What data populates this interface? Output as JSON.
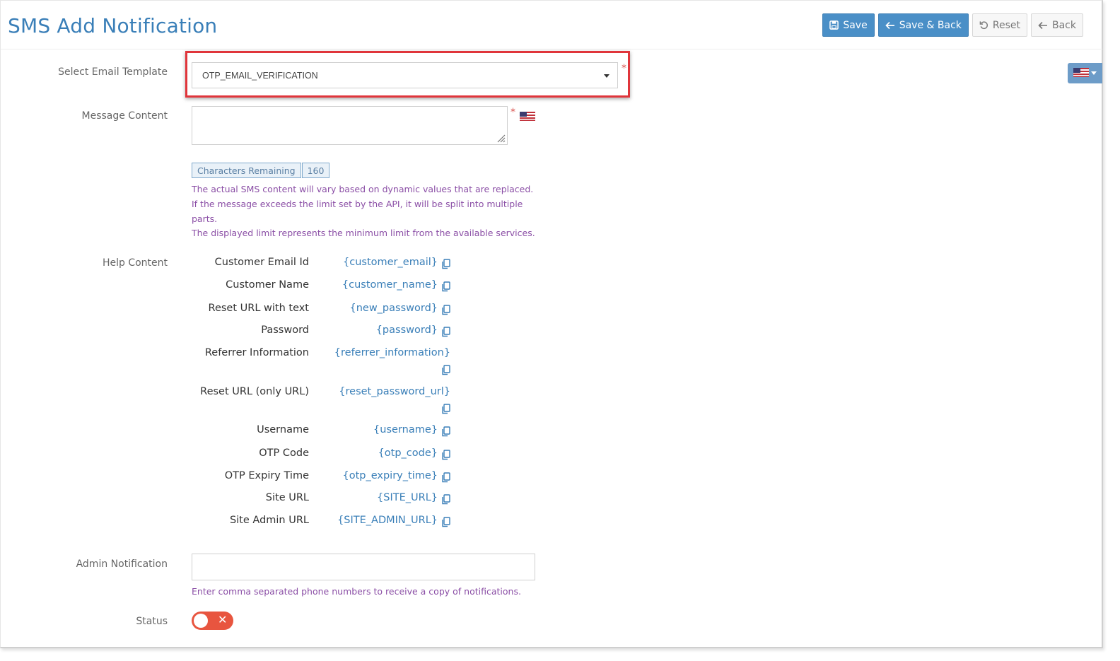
{
  "header": {
    "title": "SMS Add Notification",
    "buttons": {
      "save": "Save",
      "save_back": "Save & Back",
      "reset": "Reset",
      "back": "Back"
    }
  },
  "form": {
    "template": {
      "label": "Select Email Template",
      "value": "OTP_EMAIL_VERIFICATION",
      "required_mark": "*"
    },
    "message": {
      "label": "Message Content",
      "value": "",
      "required_mark": "*",
      "chars_label": "Characters Remaining",
      "chars_value": "160",
      "hints": [
        "The actual SMS content will vary based on dynamic values that are replaced.",
        "If the message exceeds the limit set by the API, it will be split into multiple parts.",
        "The displayed limit represents the minimum limit from the available services."
      ]
    },
    "help": {
      "label": "Help Content",
      "items": [
        {
          "name": "Customer Email Id",
          "tag": "{customer_email}"
        },
        {
          "name": "Customer Name",
          "tag": "{customer_name}"
        },
        {
          "name": "Reset URL with text",
          "tag": "{new_password}"
        },
        {
          "name": "Password",
          "tag": "{password}"
        },
        {
          "name": "Referrer Information",
          "tag": "{referrer_information}"
        },
        {
          "name": "Reset URL (only URL)",
          "tag": "{reset_password_url}"
        },
        {
          "name": "Username",
          "tag": "{username}"
        },
        {
          "name": "OTP Code",
          "tag": "{otp_code}"
        },
        {
          "name": "OTP Expiry Time",
          "tag": "{otp_expiry_time}"
        },
        {
          "name": "Site URL",
          "tag": "{SITE_URL}"
        },
        {
          "name": "Site Admin URL",
          "tag": "{SITE_ADMIN_URL}"
        }
      ]
    },
    "admin": {
      "label": "Admin Notification",
      "value": "",
      "hint": "Enter comma separated phone numbers to receive a copy of notifications."
    },
    "status": {
      "label": "Status",
      "enabled": false
    }
  },
  "icons": {
    "save": "floppy-icon",
    "save_back": "arrow-left-icon",
    "reset": "undo-icon",
    "back": "arrow-left-icon",
    "copy": "copy-icon",
    "flag": "us-flag-icon"
  },
  "colors": {
    "primary": "#4a8fc7",
    "title": "#3a7fb8",
    "hint": "#8b4fa6",
    "required": "#d9534f",
    "toggle_off": "#e8553f",
    "highlight": "#e0353b"
  }
}
